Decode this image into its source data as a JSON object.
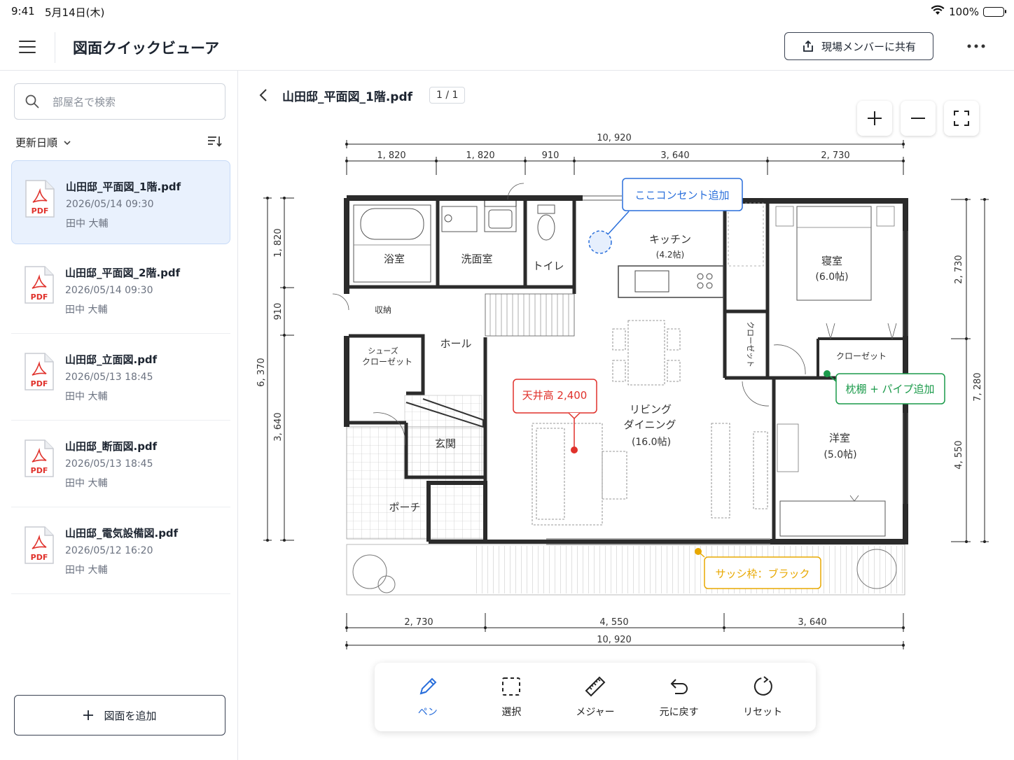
{
  "status": {
    "time": "9:41",
    "date": "5月14日(木)",
    "battery": "100%"
  },
  "app": {
    "title": "図面クイックビューア",
    "share_label": "現場メンバーに共有"
  },
  "sidebar": {
    "search_placeholder": "部屋名で検索",
    "sort_label": "更新日順",
    "files": [
      {
        "name": "山田邸_平面図_1階.pdf",
        "date": "2026/05/14 09:30",
        "user": "田中 大輔",
        "icon": "PDF"
      },
      {
        "name": "山田邸_平面図_2階.pdf",
        "date": "2026/05/14 09:30",
        "user": "田中 大輔",
        "icon": "PDF"
      },
      {
        "name": "山田邸_立面図.pdf",
        "date": "2026/05/13 18:45",
        "user": "田中 大輔",
        "icon": "PDF"
      },
      {
        "name": "山田邸_断面図.pdf",
        "date": "2026/05/13 18:45",
        "user": "田中 大輔",
        "icon": "PDF"
      },
      {
        "name": "山田邸_電気設備図.pdf",
        "date": "2026/05/12 16:20",
        "user": "田中 大輔",
        "icon": "PDF"
      }
    ],
    "add_label": "図面を追加"
  },
  "viewer": {
    "doc_title": "山田邸_平面図_1階.pdf",
    "page": "1 / 1"
  },
  "plan": {
    "dims_top_total": "10, 920",
    "dims_top": [
      "1, 820",
      "1, 820",
      "910",
      "3, 640",
      "2, 730"
    ],
    "dims_bottom": [
      "2, 730",
      "4, 550",
      "3, 640"
    ],
    "dims_bottom_total": "10, 920",
    "dims_left_total": "6, 370",
    "dims_left": [
      "1, 820",
      "910",
      "3, 640"
    ],
    "dims_right_total": "7, 280",
    "dims_right": [
      "2, 730",
      "4, 550"
    ],
    "rooms": {
      "bath": "浴室",
      "wash": "洗面室",
      "toilet": "トイレ",
      "kitchen": "キッチン",
      "kitchen_size": "(4.2帖)",
      "storage": "収納",
      "hall": "ホール",
      "shoes": "シューズ",
      "closet_small": "クローゼット",
      "entrance": "玄関",
      "porch": "ポーチ",
      "living1": "リビング",
      "living2": "ダイニング",
      "living_size": "(16.0帖)",
      "closet_v": "クローゼット",
      "bedroom": "寝室",
      "bedroom_size": "(6.0帖)",
      "closet_bed": "クローゼット",
      "western": "洋室",
      "western_size": "(5.0帖)"
    },
    "annotations": {
      "outlet": "ここコンセント追加",
      "ceiling": "天井高 2,400",
      "shelf": "枕棚 + パイプ追加",
      "sash": "サッシ枠：ブラック"
    },
    "colors": {
      "blue": "#2a6fdb",
      "red": "#e0312b",
      "green": "#1a9a4a",
      "yellow": "#e8a800"
    }
  },
  "toolbar": {
    "pen": "ペン",
    "select": "選択",
    "measure": "メジャー",
    "undo": "元に戻す",
    "reset": "リセット"
  }
}
